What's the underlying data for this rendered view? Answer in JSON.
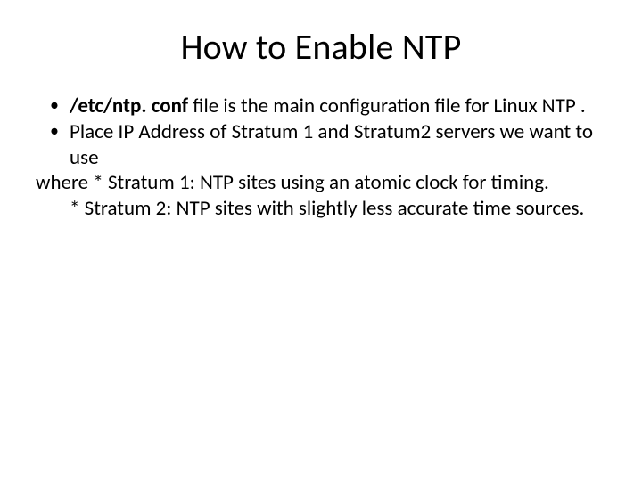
{
  "title": "How to Enable NTP",
  "bullets": {
    "b1_bold": "/etc/ntp. conf",
    "b1_rest": " file is the main configuration file for Linux NTP .",
    "b2": "Place IP Address of Stratum 1 and Stratum2 servers we want to use",
    "line_where": " where * Stratum 1: NTP sites using an atomic clock for timing.",
    "line_stratum2": "* Stratum 2: NTP sites with slightly less accurate time sources."
  },
  "bullet_char": "•"
}
